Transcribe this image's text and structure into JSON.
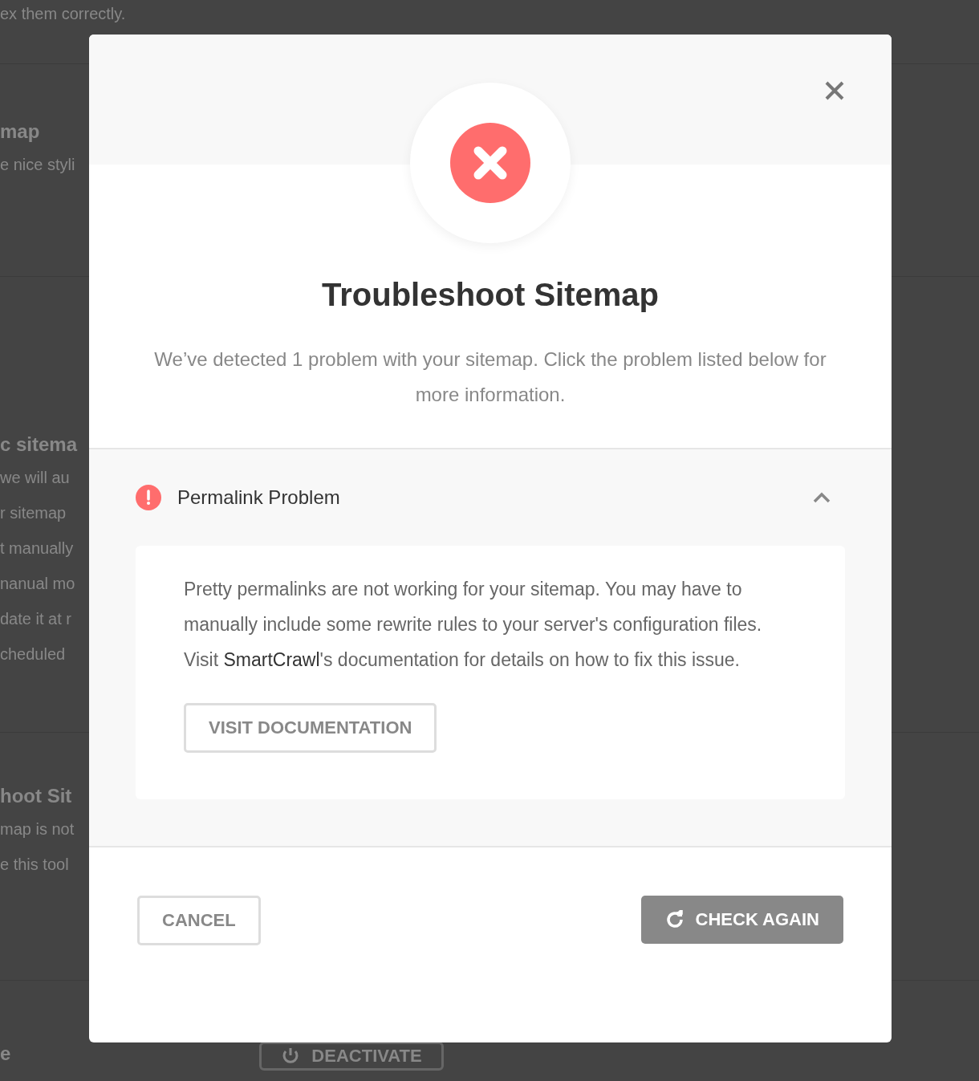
{
  "background": {
    "sections": [
      {
        "lines": [
          "ex them correctly."
        ]
      },
      {
        "title": "map",
        "lines": [
          "e nice styli"
        ]
      },
      {
        "title": "c sitema",
        "lines": [
          "we will au",
          "r sitemap",
          "t manually",
          "nanual mo",
          "date it at r",
          "cheduled"
        ]
      },
      {
        "title": "hoot Sit",
        "lines": [
          "map is not",
          "e this tool"
        ]
      },
      {
        "title": "e"
      }
    ],
    "deactivate_button": "DEACTIVATE"
  },
  "modal": {
    "title": "Troubleshoot Sitemap",
    "description": "We’ve detected 1 problem with your sitemap. Click the problem listed below for more information.",
    "problems": [
      {
        "title": "Permalink Problem",
        "expanded": true,
        "text": "Pretty permalinks are not working for your sitemap. You may have to manually include some rewrite rules to your server's configuration files. Visit **SmartCrawl**'s documentation for details on how to fix this issue.",
        "button": "VISIT DOCUMENTATION"
      }
    ],
    "cancel_button": "CANCEL",
    "check_button": "CHECK AGAIN"
  }
}
